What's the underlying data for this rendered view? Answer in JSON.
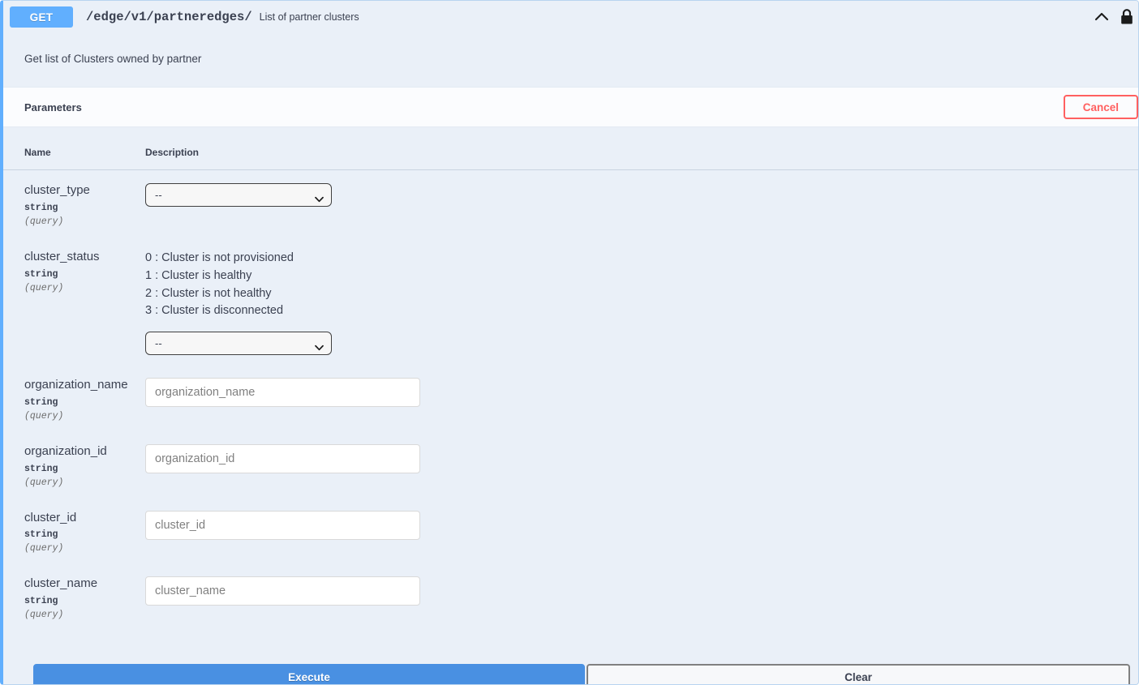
{
  "operation": {
    "method": "GET",
    "path": "/edge/v1/partneredges/",
    "summary": "List of partner clusters",
    "description": "Get list of Clusters owned by partner",
    "collapse_icon": "chevron-up-icon",
    "auth_icon": "lock-icon",
    "method_color": "#61affe"
  },
  "parameters_section": {
    "title": "Parameters",
    "cancel_label": "Cancel",
    "cancel_color": "#ff6060",
    "columns": {
      "name": "Name",
      "description": "Description"
    },
    "rows": [
      {
        "name": "cluster_type",
        "type": "string",
        "in": "(query)",
        "control": "select",
        "selected": "--",
        "options": [
          "--"
        ],
        "enum_description": []
      },
      {
        "name": "cluster_status",
        "type": "string",
        "in": "(query)",
        "control": "select",
        "selected": "--",
        "options": [
          "--"
        ],
        "enum_description": [
          "0 : Cluster is not provisioned",
          "1 : Cluster is healthy",
          "2 : Cluster is not healthy",
          "3 : Cluster is disconnected"
        ]
      },
      {
        "name": "organization_name",
        "type": "string",
        "in": "(query)",
        "control": "input",
        "value": "",
        "placeholder": "organization_name",
        "enum_description": []
      },
      {
        "name": "organization_id",
        "type": "string",
        "in": "(query)",
        "control": "input",
        "value": "",
        "placeholder": "organization_id",
        "enum_description": []
      },
      {
        "name": "cluster_id",
        "type": "string",
        "in": "(query)",
        "control": "input",
        "value": "",
        "placeholder": "cluster_id",
        "enum_description": []
      },
      {
        "name": "cluster_name",
        "type": "string",
        "in": "(query)",
        "control": "input",
        "value": "",
        "placeholder": "cluster_name",
        "enum_description": []
      }
    ]
  },
  "actions": {
    "execute_label": "Execute",
    "execute_color": "#4990e2",
    "clear_label": "Clear"
  }
}
